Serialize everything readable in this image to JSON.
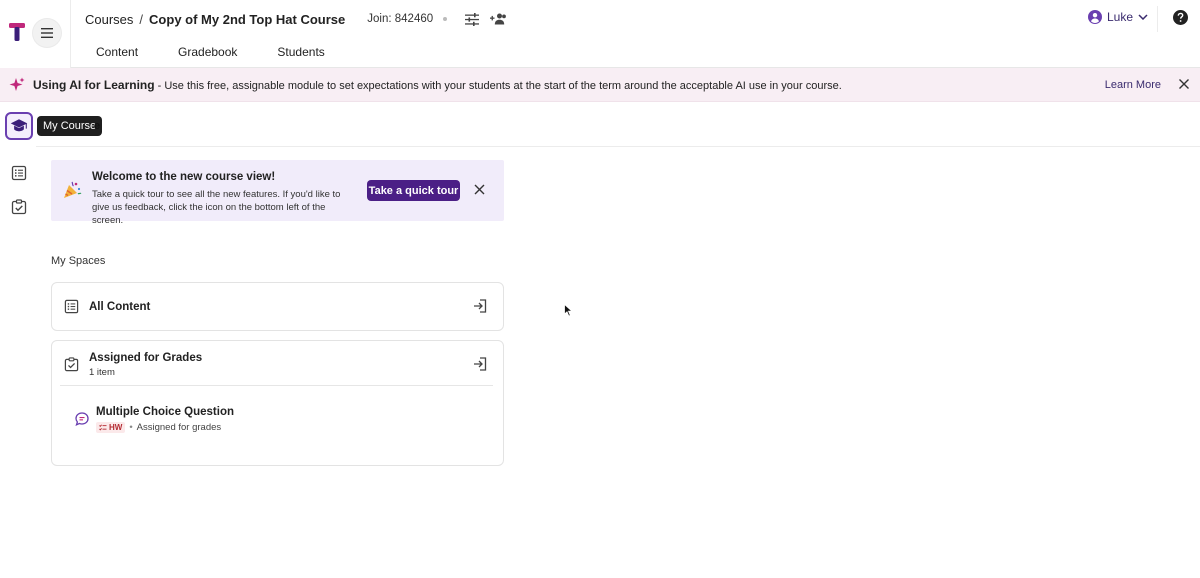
{
  "rail": {
    "logo": "tophat-logo-icon",
    "items": [
      {
        "icon": "graduation-cap-icon",
        "active": true
      },
      {
        "icon": "list-icon",
        "active": false
      },
      {
        "icon": "clipboard-check-icon",
        "active": false
      }
    ]
  },
  "header": {
    "breadcrumb_root": "Courses",
    "breadcrumb_sep": "/",
    "course_title": "Copy of My 2nd Top Hat Course",
    "join_code": "Join: 842460",
    "tabs": [
      {
        "label": "Content"
      },
      {
        "label": "Gradebook"
      },
      {
        "label": "Students"
      }
    ],
    "user_name": "Luke"
  },
  "banner": {
    "title": "Using AI for Learning",
    "text": " - Use this free, assignable module to set expectations with your students at the start of the term around the acceptable AI use in your course.",
    "learn_more": "Learn More"
  },
  "tooltip": {
    "text": "My Course",
    "tail": "e"
  },
  "welcome": {
    "title": "Welcome to the new course view!",
    "body": "Take a quick tour to see all the new features. If you'd like to give us feedback, click the icon on the bottom left of the screen.",
    "button": "Take a quick tour"
  },
  "spaces": {
    "label": "My Spaces",
    "all_content": {
      "title": "All Content"
    },
    "assigned": {
      "title": "Assigned for Grades",
      "count": "1 item",
      "item": {
        "title": "Multiple Choice Question",
        "badge": "HW",
        "status": "Assigned for grades"
      }
    }
  },
  "colors": {
    "brand": "#4b1f86",
    "accent_active": "#6a3fb0",
    "banner_bg": "#f8eef4",
    "welcome_bg": "#f1ecfa",
    "hw_badge": "#b42b33"
  }
}
